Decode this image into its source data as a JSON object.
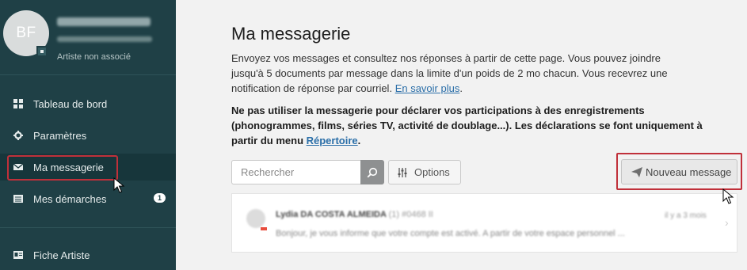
{
  "sidebar": {
    "avatar_initials": "BF",
    "profile_role": "Artiste non associé",
    "items": [
      {
        "label": "Tableau de bord",
        "icon": "dashboard-icon"
      },
      {
        "label": "Paramètres",
        "icon": "gear-icon"
      },
      {
        "label": "Ma messagerie",
        "icon": "envelope-icon",
        "active": true
      },
      {
        "label": "Mes démarches",
        "icon": "list-icon",
        "badge": "1"
      },
      {
        "label": "Fiche Artiste",
        "icon": "id-card-icon"
      }
    ]
  },
  "main": {
    "title": "Ma messagerie",
    "intro_text": "Envoyez vos messages et consultez nos réponses à partir de cette page. Vous pouvez joindre jusqu'à 5 documents par message dans la limite d'un poids de 2 mo chacun. Vous recevrez une notification de réponse par courriel. ",
    "intro_link": "En savoir plus",
    "intro_end": ".",
    "warning_text": "Ne pas utiliser la messagerie pour déclarer vos participations à des enregistrements (phonogrammes, films, séries TV, activité de doublage...). Les déclarations se font uniquement à partir du menu ",
    "warning_link": "Répertoire",
    "warning_end": ".",
    "search_placeholder": "Rechercher",
    "options_label": "Options",
    "new_message_label": "Nouveau message",
    "messages": [
      {
        "sender": "Lydia DA COSTA ALMEIDA",
        "ref": "(1) #0468 II",
        "date": "il y a 3 mois",
        "preview": "Bonjour, je vous informe que votre compte est activé. A partir de votre espace personnel ..."
      }
    ]
  },
  "colors": {
    "sidebar_bg": "#1f4046",
    "highlight": "#c0303a",
    "link": "#2a6ea8"
  }
}
